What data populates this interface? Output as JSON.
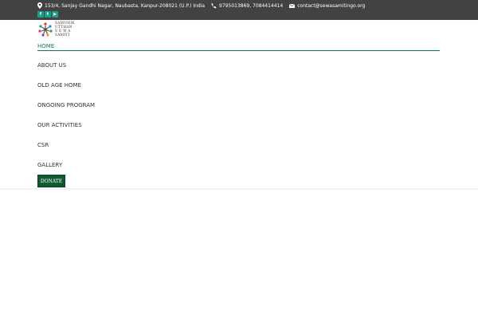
{
  "topbar": {
    "address": "153/4, Sanjay Gandhi Nagar, Naubasta, Kanpur-208021 (U.P.) India",
    "phone": "9795013869, 7084414414",
    "email": "contact@sewasamitingo.org",
    "background_color": "#424242"
  },
  "socials": [
    {
      "name": "facebook-icon",
      "glyph": "f"
    },
    {
      "name": "twitter-icon",
      "glyph": "t"
    },
    {
      "name": "youtube-icon",
      "glyph": "▶"
    }
  ],
  "logo": {
    "lines": [
      "SAMUHIK",
      "UTTHAN",
      "SEWA",
      "SAMITI"
    ]
  },
  "nav": {
    "items": [
      {
        "label": "HOME",
        "active": true
      },
      {
        "label": "ABOUT US",
        "active": false
      },
      {
        "label": "OLD AGE HOME",
        "active": false
      },
      {
        "label": "ONGOING PROGRAM",
        "active": false
      },
      {
        "label": "OUR ACTIVITIES",
        "active": false
      },
      {
        "label": "CSR",
        "active": false
      },
      {
        "label": "GALLERY",
        "active": false
      }
    ],
    "active_color": "#137a4d"
  },
  "donate": {
    "label": "DONATE",
    "color": "#0c5a2e"
  }
}
